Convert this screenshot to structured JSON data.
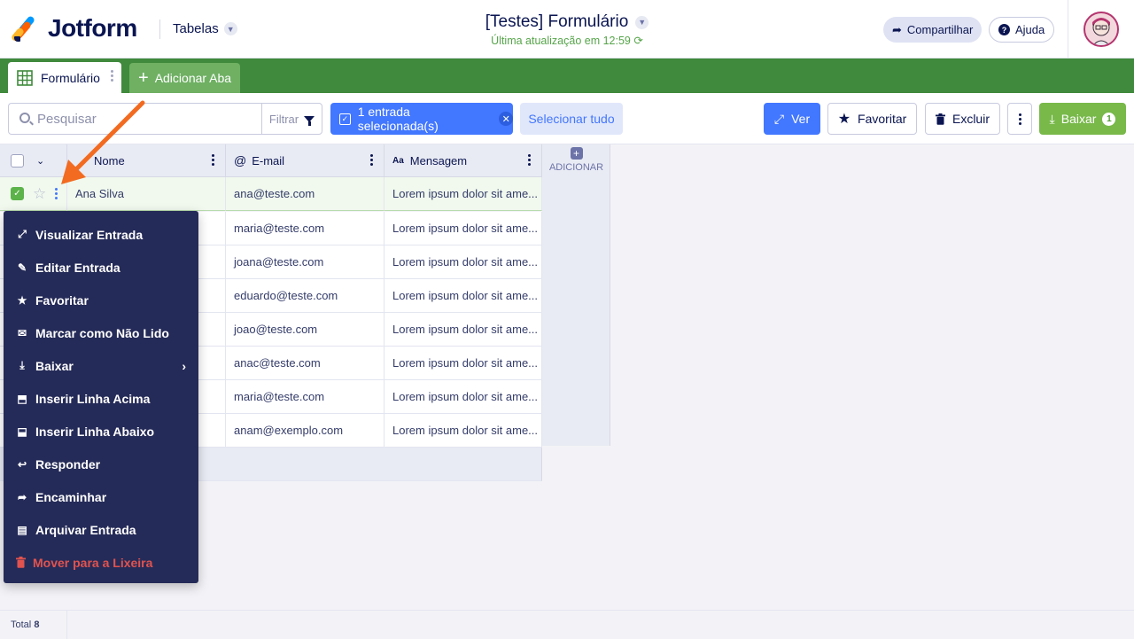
{
  "header": {
    "brand": "Jotform",
    "section": "Tabelas",
    "title": "[Testes] Formulário",
    "subtitle": "Última atualização em 12:59",
    "share_label": "Compartilhar",
    "help_label": "Ajuda"
  },
  "tabs": {
    "active_label": "Formulário",
    "add_label": "Adicionar Aba"
  },
  "toolbar": {
    "search_placeholder": "Pesquisar",
    "filter_label": "Filtrar",
    "selected_label": "1 entrada selecionada(s)",
    "select_all_label": "Selecionar tudo",
    "view_label": "Ver",
    "favorite_label": "Favoritar",
    "delete_label": "Excluir",
    "download_label": "Baixar",
    "download_count": "1"
  },
  "table": {
    "columns": [
      "Nome",
      "E-mail",
      "Mensagem"
    ],
    "add_column_label": "ADICIONAR",
    "rows": [
      {
        "name": "Ana Silva",
        "email": "ana@teste.com",
        "message": "Lorem ipsum dolor sit ame..."
      },
      {
        "name": "",
        "email": "maria@teste.com",
        "message": "Lorem ipsum dolor sit ame..."
      },
      {
        "name": "",
        "email": "joana@teste.com",
        "message": "Lorem ipsum dolor sit ame..."
      },
      {
        "name": "",
        "email": "eduardo@teste.com",
        "message": "Lorem ipsum dolor sit ame..."
      },
      {
        "name": "",
        "email": "joao@teste.com",
        "message": "Lorem ipsum dolor sit ame..."
      },
      {
        "name": "",
        "email": "anac@teste.com",
        "message": "Lorem ipsum dolor sit ame..."
      },
      {
        "name": "",
        "email": "maria@teste.com",
        "message": "Lorem ipsum dolor sit ame..."
      },
      {
        "name": "",
        "email": "anam@exemplo.com",
        "message": "Lorem ipsum dolor sit ame..."
      }
    ]
  },
  "context_menu": {
    "items": [
      {
        "label": "Visualizar Entrada",
        "icon": "expand-icon"
      },
      {
        "label": "Editar Entrada",
        "icon": "edit-icon"
      },
      {
        "label": "Favoritar",
        "icon": "star-icon"
      },
      {
        "label": "Marcar como Não Lido",
        "icon": "envelope-icon"
      },
      {
        "label": "Baixar",
        "icon": "download-icon"
      },
      {
        "label": "Inserir Linha Acima",
        "icon": "insert-above-icon"
      },
      {
        "label": "Inserir Linha Abaixo",
        "icon": "insert-below-icon"
      },
      {
        "label": "Responder",
        "icon": "reply-icon"
      },
      {
        "label": "Encaminhar",
        "icon": "forward-icon"
      },
      {
        "label": "Arquivar Entrada",
        "icon": "archive-icon"
      },
      {
        "label": "Mover para a Lixeira",
        "icon": "trash-icon"
      }
    ]
  },
  "footer": {
    "total_label": "Total",
    "total_value": "8"
  },
  "colors": {
    "brand_green": "#3f8a3c",
    "primary_blue": "#4277ff",
    "menu_bg": "#252b58",
    "annotation_arrow": "#f26b21"
  }
}
